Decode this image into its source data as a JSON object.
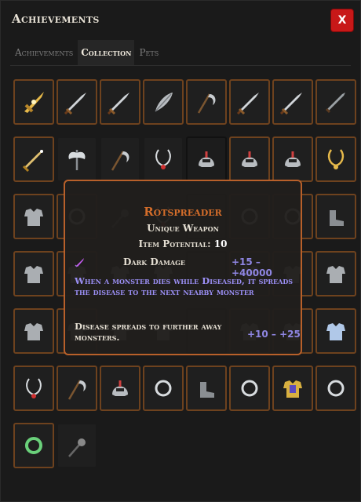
{
  "window": {
    "title": "Achievements",
    "close_label": "X"
  },
  "tabs": [
    {
      "label": "Achievements",
      "active": false
    },
    {
      "label": "Collection",
      "active": true
    },
    {
      "label": "Pets",
      "active": false
    }
  ],
  "collection": {
    "rows": [
      [
        {
          "icon": "ornate-gold-sword-icon",
          "rarity": "unique"
        },
        {
          "icon": "sword-icon",
          "rarity": "unique"
        },
        {
          "icon": "sword-icon",
          "rarity": "unique"
        },
        {
          "icon": "leaf-blade-icon",
          "rarity": "unique"
        },
        {
          "icon": "scythe-icon",
          "rarity": "unique"
        },
        {
          "icon": "sword-icon",
          "rarity": "unique"
        },
        {
          "icon": "sword-icon",
          "rarity": "unique"
        },
        {
          "icon": "dagger-icon",
          "rarity": "unique"
        }
      ],
      [
        {
          "icon": "gold-sword-icon",
          "rarity": "unique"
        },
        {
          "icon": "double-axe-icon",
          "rarity": "magic"
        },
        {
          "icon": "scythe-icon",
          "rarity": "magic"
        },
        {
          "icon": "amulet-icon",
          "rarity": "magic"
        },
        {
          "icon": "helmet-icon",
          "rarity": "empty"
        },
        {
          "icon": "helmet-icon",
          "rarity": "unique"
        },
        {
          "icon": "helmet-icon",
          "rarity": "unique"
        },
        {
          "icon": "gold-amulet-icon",
          "rarity": "unique"
        }
      ],
      [
        {
          "icon": "chest-armor-icon",
          "rarity": "unique"
        },
        {
          "icon": "ring-icon",
          "rarity": "unique"
        },
        {
          "icon": "mace-icon",
          "rarity": "magic"
        },
        {
          "icon": "amulet-icon",
          "rarity": "magic"
        },
        {
          "icon": "empty-icon",
          "rarity": "empty"
        },
        {
          "icon": "ring-icon",
          "rarity": "unique"
        },
        {
          "icon": "ring-icon",
          "rarity": "unique"
        },
        {
          "icon": "boots-icon",
          "rarity": "unique"
        }
      ],
      [
        {
          "icon": "chest-armor-icon",
          "rarity": "unique"
        },
        {
          "icon": "chest-armor-icon",
          "rarity": "unique"
        },
        {
          "icon": "chest-armor-icon",
          "rarity": "magic"
        },
        {
          "icon": "chest-armor-icon",
          "rarity": "magic"
        },
        {
          "icon": "empty-icon",
          "rarity": "empty"
        },
        {
          "icon": "chest-armor-icon",
          "rarity": "unique"
        },
        {
          "icon": "chest-armor-icon",
          "rarity": "unique"
        },
        {
          "icon": "chest-armor-icon",
          "rarity": "unique"
        }
      ],
      [
        {
          "icon": "chest-armor-icon",
          "rarity": "unique"
        },
        {
          "icon": "chest-armor-icon",
          "rarity": "unique"
        },
        {
          "icon": "chest-armor-icon",
          "rarity": "magic"
        },
        {
          "icon": "chest-armor-icon",
          "rarity": "magic"
        },
        {
          "icon": "empty-icon",
          "rarity": "empty"
        },
        {
          "icon": "chest-armor-icon",
          "rarity": "unique"
        },
        {
          "icon": "chest-armor-icon",
          "rarity": "unique"
        },
        {
          "icon": "blue-chest-armor-icon",
          "rarity": "unique"
        }
      ],
      [
        {
          "icon": "amulet-icon",
          "rarity": "unique"
        },
        {
          "icon": "scythe-icon",
          "rarity": "unique"
        },
        {
          "icon": "helmet-icon",
          "rarity": "unique"
        },
        {
          "icon": "ring-icon",
          "rarity": "unique"
        },
        {
          "icon": "boots-icon",
          "rarity": "unique"
        },
        {
          "icon": "ring-icon",
          "rarity": "unique"
        },
        {
          "icon": "gold-chest-armor-icon",
          "rarity": "unique"
        },
        {
          "icon": "ring-icon",
          "rarity": "unique"
        }
      ],
      [
        {
          "icon": "green-ring-icon",
          "rarity": "unique"
        },
        {
          "icon": "mace-icon",
          "rarity": "magic"
        }
      ]
    ]
  },
  "tooltip": {
    "name": "Rotspreader",
    "type": "Unique Weapon",
    "potential_label": "Item Potential:",
    "potential_value": "10",
    "mod_name": "Dark Damage",
    "mod_range": "+15 – +40000",
    "description": "When a monster dies while Diseased, it spreads the disease to the next nearby monster",
    "extra_text": "Disease spreads to further away monsters.",
    "extra_range": "+10 – +25",
    "colors": {
      "border": "#b8602a",
      "name": "#d46d2a",
      "magic_text": "#9b8ff5"
    }
  }
}
